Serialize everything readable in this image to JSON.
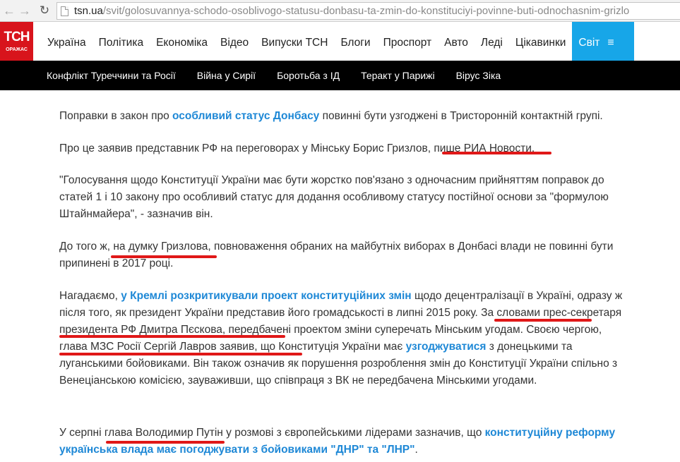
{
  "browser": {
    "url_host": "tsn.ua",
    "url_path": "/svit/golosuvannya-schodo-osoblivogo-statusu-donbasu-ta-zmin-do-konstituciyi-povinne-buti-odnochasnim-grizlo"
  },
  "site": {
    "logo_text": "ТСН",
    "logo_sub": "ОРАЖАС",
    "nav": [
      "Україна",
      "Політика",
      "Економіка",
      "Відео",
      "Випуски ТСН",
      "Блоги",
      "Проспорт",
      "Авто",
      "Леді",
      "Цікавинки",
      "Світ"
    ],
    "menu_icon": "≡",
    "topics": [
      "Конфлікт Туреччини та Росії",
      "Війна у Сирії",
      "Боротьба з ІД",
      "Теракт у Парижі",
      "Вірус Зіка"
    ]
  },
  "article": {
    "p1": {
      "pre": "Поправки в закон про ",
      "link": "особливий статус Донбасу",
      "post": " повинні бути узгоджені в Тристоронній контактній групі."
    },
    "p2": {
      "pre": "Про це заявив представник РФ на переговорах у Мінську Борис Гризлов, ",
      "link": "пише РИА Новости",
      "post": "."
    },
    "p3": "\"Голосування щодо Конституції України має бути жорстко пов'язано з одночасним прийняттям поправок до статей 1 і 10 закону про особливий статус для додання особливому статусу постійної основи за \"формулою Штайнмайера\", - зазначив він.",
    "p4": "До того ж, на думку Гризлова, повноваження обраних на майбутніх виборах в Донбасі влади не повинні бути припинені в 2017 році.",
    "p5": {
      "pre": "Нагадаємо, ",
      "link1": "у Кремлі розкритикували проект конституційних змін",
      "mid1": " щодо децентралізації в Україні, одразу ж після того, як президент України представив його громадськості в липні 2015 року. За словами прес-секретаря президента РФ Дмитра Пєскова, передбачені проектом зміни суперечать Мінським угодам. Своєю чергою, глава МЗС Росії Сергій Лавров заявив, що Конституція України має ",
      "link2": "узгоджуватися",
      "post": " з донецькими та луганськими бойовиками. Він також означив як порушення розроблення змін до Конституції України спільно з Венеціанською комісією, зауваживши, що співпраця з ВК не передбачена Мінськими угодами."
    },
    "p6": {
      "pre": "У серпні глава Володимир Путін у розмові з європейськими лідерами зазначив, що ",
      "link": "конституційну реформу українська влада має погоджувати з бойовиками \"ДНР\" та \"ЛНР\"",
      "post": "."
    }
  },
  "colors": {
    "logo_red": "#d8141c",
    "active_blue": "#17a6e8",
    "link_blue": "#1e88d6",
    "underline_red": "#e01818"
  }
}
